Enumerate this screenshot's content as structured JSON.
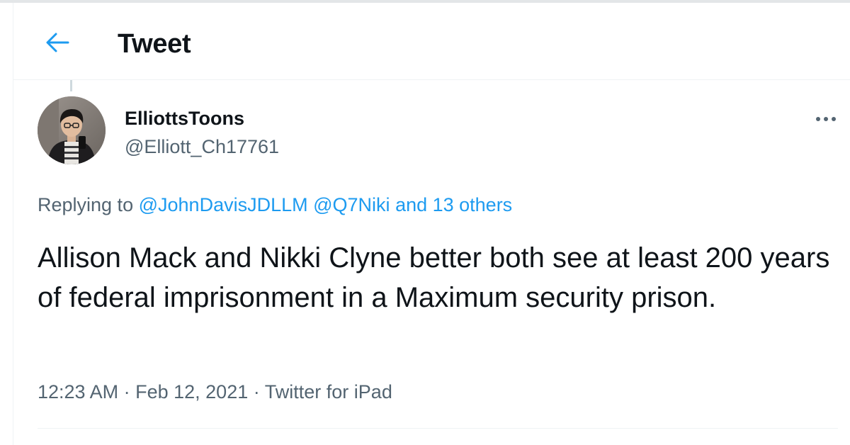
{
  "header": {
    "title": "Tweet",
    "back_icon": "arrow-left-icon"
  },
  "colors": {
    "accent": "#1d9bf0",
    "text_primary": "#0f1419",
    "text_secondary": "#536471",
    "divider": "#eff3f4"
  },
  "tweet": {
    "author": {
      "display_name": "ElliottsToons",
      "handle": "@Elliott_Ch17761"
    },
    "more_icon": "more-horizontal-icon",
    "reply": {
      "prefix": "Replying to",
      "mention1": "@JohnDavisJDLLM",
      "mention2": "@Q7Niki",
      "others": "and 13 others"
    },
    "text": "Allison Mack and Nikki Clyne better both see at least 200 years of federal imprisonment in a Maximum security prison.",
    "meta": {
      "time": "12:23 AM",
      "separator": "·",
      "date": "Feb 12, 2021",
      "source": "Twitter for iPad"
    }
  }
}
